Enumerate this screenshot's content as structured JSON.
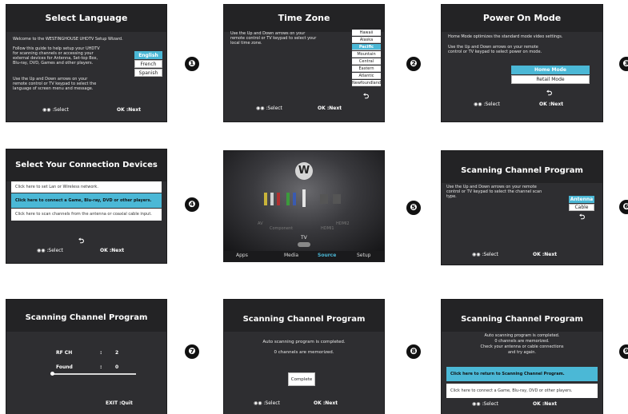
{
  "markers": [
    "❶",
    "❷",
    "❸",
    "❹",
    "❺",
    "❻",
    "❼",
    "❽",
    "❾"
  ],
  "nav_select": "◉◉ :Select",
  "nav_next": "OK :Next",
  "return_icon": "⮌",
  "s1": {
    "title": "Select Language",
    "welcome": "Welcome to the WESTINGHOUSE UHDTV Setup Wizard.",
    "guide": "Follow this guide to help setup your UHDTV for scanning channels or accessing your external devices for Antenna, Set-top Box, Blu-ray, DVD, Games and other players.",
    "instr": "Use the Up and Down arrows on your remote control or TV keypad to select the language of screen menu and message.",
    "options": [
      "English",
      "French",
      "Spanish"
    ]
  },
  "s2": {
    "title": "Time Zone",
    "instr": "Use the Up and Down arrows on your remote control or TV keypad to select your local time zone.",
    "zones": [
      "Hawaii",
      "Alaska",
      "Pacific",
      "Mountain",
      "Central",
      "Eastern",
      "Atlantic",
      "Newfoundland"
    ]
  },
  "s3": {
    "title": "Power On Mode",
    "line1": "Home Mode optimizes the standard mode video settings.",
    "line2": "Use the Up and Down arrows on your remote control or TV keypad to select power on mode.",
    "options": [
      "Home Mode",
      "Retail Mode"
    ]
  },
  "s4": {
    "title": "Select Your Connection Devices",
    "items": [
      "Click here to set Lan or Wireless network.",
      "Click here to connect a Game, Blu-ray, DVD or other players.",
      "Click here to scan channels from the antenna or coaxial cable input."
    ]
  },
  "s5": {
    "logo": "W",
    "ports": [
      "AV",
      "Component",
      "HDMI1",
      "HDMI2"
    ],
    "source": "TV",
    "menu": [
      "Apps",
      "Media",
      "Source",
      "Setup"
    ]
  },
  "s6": {
    "title": "Scanning Channel Program",
    "instr": "Use the Up and Down arrows on your remote control or TV keypad to select the channel scan type.",
    "options": [
      "Antenna",
      "Cable"
    ]
  },
  "s7": {
    "title": "Scanning Channel Program",
    "rf_label": "RF CH",
    "rf_sep": ":",
    "rf_value": "2",
    "found_label": "Found",
    "found_sep": ":",
    "found_value": "0",
    "exit": "EXIT :Quit"
  },
  "s8": {
    "title": "Scanning Channel Program",
    "line1": "Auto scanning program is completed.",
    "line2": "0 channels are memorized.",
    "button": "Complete"
  },
  "s9": {
    "title": "Scanning Channel Program",
    "lines": [
      "Auto scanning program is completed.",
      "0 channels are memorized.",
      "Check your antenna or cable connections",
      "and try again."
    ],
    "items": [
      "Click here to return to Scanning Channel Program.",
      "Click here to connect a Game, Blu-ray, DVD or other players."
    ]
  }
}
